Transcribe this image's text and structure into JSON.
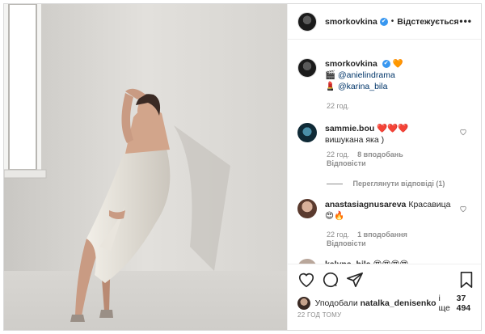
{
  "post": {
    "username": "smorkovkina",
    "follow_label": "Відстежується",
    "separator": "•",
    "more_label": "•••"
  },
  "caption": {
    "username": "smorkovkina",
    "heart_emoji": "🧡",
    "line1_emoji": "🎬",
    "line1_mention": "@anielindrama",
    "line2_emoji": "💄",
    "line2_mention": "@karina_bila",
    "time": "22 год."
  },
  "comments": [
    {
      "username": "sammie.bou",
      "text": "❤️❤️❤️вишукана яка )",
      "time": "22 год.",
      "likes": "8 вподобань",
      "reply": "Відповісти",
      "view_replies": "Переглянути відповіді (1)"
    },
    {
      "username": "anastasiagnusareva",
      "text": "Красавица",
      "text2": "😍🔥",
      "time": "22 год.",
      "likes": "1 вподобання",
      "reply": "Відповісти"
    },
    {
      "username": "kalyna_bila",
      "text": "😍😍😍😍"
    }
  ],
  "likes": {
    "prefix": "Уподобали",
    "user": "natalka_denisenko",
    "middle": "і ще",
    "count": "37 494"
  },
  "timestamp": "22 ГОД ТОМУ",
  "colors": {
    "verified": "#3897f0",
    "muted": "#8e8e8e"
  }
}
